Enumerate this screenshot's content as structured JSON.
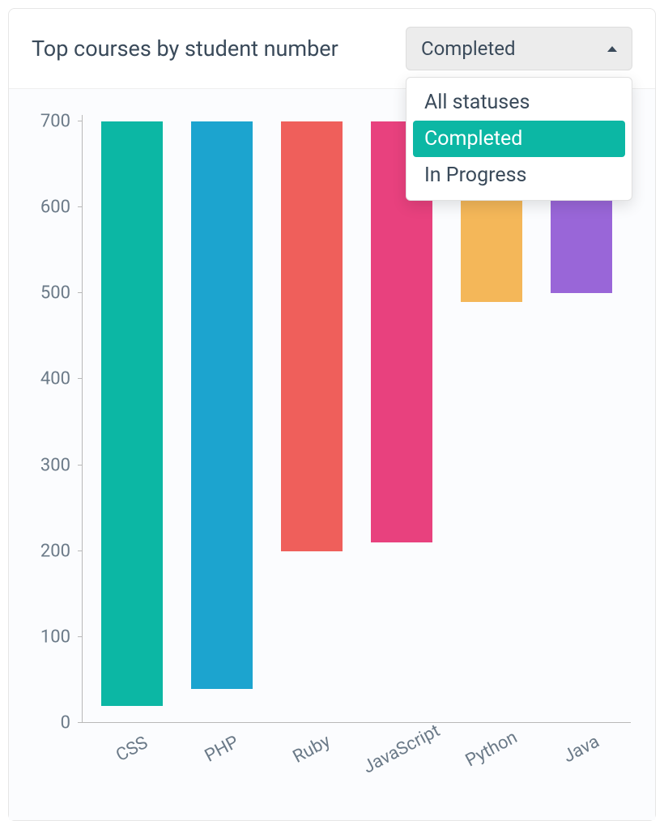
{
  "header": {
    "title": "Top courses by student number"
  },
  "dropdown": {
    "selected": "Completed",
    "options": [
      {
        "label": "All statuses",
        "active": false
      },
      {
        "label": "Completed",
        "active": true
      },
      {
        "label": "In Progress",
        "active": false
      }
    ]
  },
  "chart_data": {
    "type": "bar",
    "title": "Top courses by student number",
    "xlabel": "",
    "ylabel": "",
    "ylim": [
      0,
      700
    ],
    "y_ticks": [
      0,
      100,
      200,
      300,
      400,
      500,
      600,
      700
    ],
    "categories": [
      "CSS",
      "PHP",
      "Ruby",
      "JavaScript",
      "Python",
      "Java"
    ],
    "values": [
      680,
      660,
      500,
      490,
      210,
      200
    ],
    "colors": [
      "#0cb7a4",
      "#1ca4cf",
      "#ef5f5b",
      "#e8417e",
      "#f4b759",
      "#9966d8"
    ]
  }
}
